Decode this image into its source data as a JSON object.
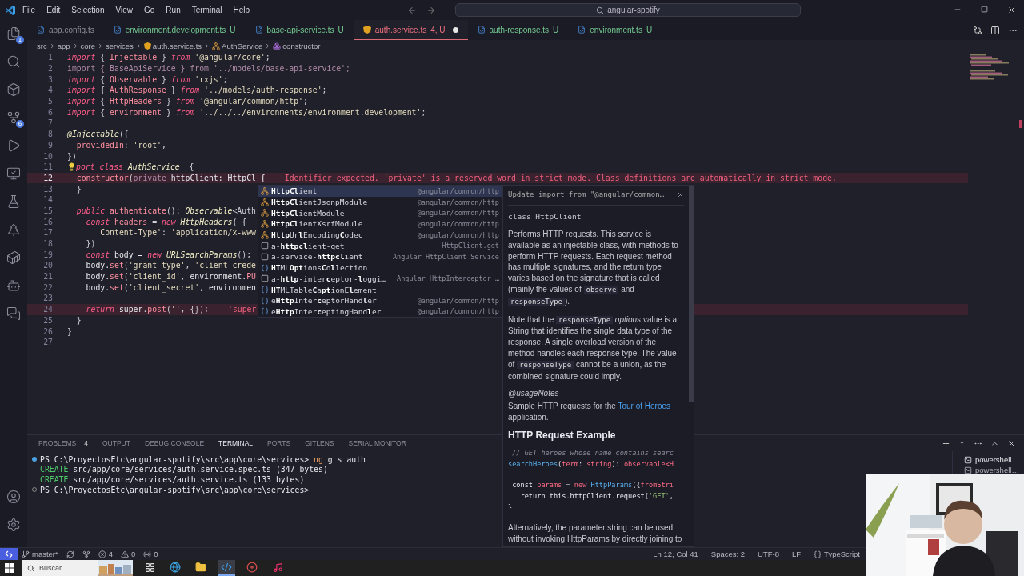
{
  "title_bar": {
    "menu": [
      "File",
      "Edit",
      "Selection",
      "View",
      "Go",
      "Run",
      "Terminal",
      "Help"
    ],
    "search": {
      "value": "angular-spotify"
    }
  },
  "activity_bar": {
    "top": [
      {
        "kind": "files",
        "badge": "1"
      },
      {
        "kind": "search"
      },
      {
        "kind": "extensions"
      },
      {
        "kind": "source-control",
        "badge": "6"
      },
      {
        "kind": "run"
      },
      {
        "kind": "remote"
      },
      {
        "kind": "testing"
      },
      {
        "kind": "tree"
      },
      {
        "kind": "docker"
      },
      {
        "kind": "bot"
      },
      {
        "kind": "chat"
      }
    ],
    "bottom": [
      {
        "kind": "account"
      },
      {
        "kind": "settings"
      }
    ]
  },
  "editor_tabs": [
    {
      "label": "app.config.ts",
      "kind": "clean",
      "selected": false
    },
    {
      "label": "environment.development.ts",
      "status": "U",
      "kind": "untracked",
      "selected": false
    },
    {
      "label": "base-api-service.ts",
      "status": "U",
      "kind": "untracked",
      "selected": false
    },
    {
      "label": "auth.service.ts",
      "status": "4, U",
      "kind": "error",
      "selected": true,
      "modified": true
    },
    {
      "label": "auth-response.ts",
      "status": "U",
      "kind": "untracked",
      "selected": false
    },
    {
      "label": "environment.ts",
      "status": "U",
      "kind": "untracked",
      "selected": false
    }
  ],
  "breadcrumbs": [
    {
      "label": "src",
      "kind": "folder"
    },
    {
      "label": "app",
      "kind": "folder"
    },
    {
      "label": "core",
      "kind": "folder"
    },
    {
      "label": "services",
      "kind": "folder"
    },
    {
      "label": "auth.service.ts",
      "kind": "file"
    },
    {
      "label": "AuthService",
      "kind": "class"
    },
    {
      "label": "constructor",
      "kind": "method"
    }
  ],
  "code_lines": [
    {
      "n": "1",
      "tokens": [
        {
          "text": "import ",
          "kind": "kw"
        },
        {
          "text": "{ ",
          "kind": "p"
        },
        {
          "text": "Injectable ",
          "kind": "id"
        },
        {
          "text": "} ",
          "kind": "p"
        },
        {
          "text": "from ",
          "kind": "kw"
        },
        {
          "text": "'@angular/core'",
          "kind": "str"
        },
        {
          "text": ";",
          "kind": "p"
        }
      ]
    },
    {
      "n": "2",
      "tokens": [
        {
          "text": "import { BaseApiService } from '../models/base-api-service';",
          "kind": "dim"
        }
      ]
    },
    {
      "n": "3",
      "tokens": [
        {
          "text": "import ",
          "kind": "kw"
        },
        {
          "text": "{ ",
          "kind": "p"
        },
        {
          "text": "Observable ",
          "kind": "id"
        },
        {
          "text": "} ",
          "kind": "p"
        },
        {
          "text": "from ",
          "kind": "kw"
        },
        {
          "text": "'rxjs'",
          "kind": "str"
        },
        {
          "text": ";",
          "kind": "p"
        }
      ]
    },
    {
      "n": "4",
      "tokens": [
        {
          "text": "import ",
          "kind": "kw"
        },
        {
          "text": "{ ",
          "kind": "p"
        },
        {
          "text": "AuthResponse ",
          "kind": "id"
        },
        {
          "text": "} ",
          "kind": "p"
        },
        {
          "text": "from ",
          "kind": "kw"
        },
        {
          "text": "'../models/auth-response'",
          "kind": "str"
        },
        {
          "text": ";",
          "kind": "p"
        }
      ]
    },
    {
      "n": "5",
      "tokens": [
        {
          "text": "import ",
          "kind": "kw"
        },
        {
          "text": "{ ",
          "kind": "p"
        },
        {
          "text": "HttpHeaders ",
          "kind": "id"
        },
        {
          "text": "} ",
          "kind": "p"
        },
        {
          "text": "from ",
          "kind": "kw"
        },
        {
          "text": "'@angular/common/http'",
          "kind": "str"
        },
        {
          "text": ";",
          "kind": "p"
        }
      ]
    },
    {
      "n": "6",
      "tokens": [
        {
          "text": "import ",
          "kind": "kw"
        },
        {
          "text": "{ ",
          "kind": "p"
        },
        {
          "text": "environment ",
          "kind": "id"
        },
        {
          "text": "} ",
          "kind": "p"
        },
        {
          "text": "from ",
          "kind": "kw"
        },
        {
          "text": "'../../../environments/environment.development'",
          "kind": "str"
        },
        {
          "text": ";",
          "kind": "p"
        }
      ]
    },
    {
      "n": "7"
    },
    {
      "n": "8",
      "tokens": [
        {
          "text": "@Injectable",
          "kind": "type"
        },
        {
          "text": "({",
          "kind": "p"
        }
      ]
    },
    {
      "n": "9",
      "tokens": [
        {
          "text": "  providedIn",
          "kind": "id"
        },
        {
          "text": ": ",
          "kind": "p"
        },
        {
          "text": "'root'",
          "kind": "str"
        },
        {
          "text": ",",
          "kind": "p"
        }
      ]
    },
    {
      "n": "10",
      "tokens": [
        {
          "text": "})",
          "kind": "p"
        }
      ]
    },
    {
      "n": "11",
      "lightbulb": true,
      "tokens": [
        {
          "text": "port ",
          "kind": "kw"
        },
        {
          "text": "class ",
          "kind": "kw"
        },
        {
          "text": "AuthService",
          "kind": "type"
        },
        {
          "text": "  {",
          "kind": "p"
        }
      ]
    },
    {
      "n": "12",
      "current": true,
      "error": "Identifier expected. 'private' is a reserved word in strict mode. Class definitions are automatically in strict mode.",
      "tokens": [
        {
          "text": "  constructor",
          "kind": "id"
        },
        {
          "text": "(",
          "kind": "p"
        },
        {
          "text": "private",
          "kind": "dim"
        },
        {
          "text": " httpClient: HttpCl {",
          "kind": "plain"
        }
      ]
    },
    {
      "n": "13",
      "tokens": [
        {
          "text": "  }",
          "kind": "p"
        }
      ]
    },
    {
      "n": "14"
    },
    {
      "n": "15",
      "tokens": [
        {
          "text": "  public ",
          "kind": "kw"
        },
        {
          "text": "authenticate",
          "kind": "fn"
        },
        {
          "text": "(): ",
          "kind": "p"
        },
        {
          "text": "Observable",
          "kind": "type"
        },
        {
          "text": "<Auth",
          "kind": "p"
        }
      ]
    },
    {
      "n": "16",
      "tokens": [
        {
          "text": "    const ",
          "kind": "kw"
        },
        {
          "text": "headers",
          "kind": "id"
        },
        {
          "text": " = ",
          "kind": "p"
        },
        {
          "text": "new ",
          "kind": "kw"
        },
        {
          "text": "HttpHeaders",
          "kind": "type"
        },
        {
          "text": "( {",
          "kind": "p"
        }
      ]
    },
    {
      "n": "17",
      "tokens": [
        {
          "text": "      'Content-Type'",
          "kind": "str"
        },
        {
          "text": ": ",
          "kind": "p"
        },
        {
          "text": "'application/x-www",
          "kind": "str"
        }
      ]
    },
    {
      "n": "18",
      "tokens": [
        {
          "text": "    })",
          "kind": "p"
        }
      ]
    },
    {
      "n": "19",
      "tokens": [
        {
          "text": "    const ",
          "kind": "kw"
        },
        {
          "text": "body = ",
          "kind": "plain"
        },
        {
          "text": "new ",
          "kind": "kw"
        },
        {
          "text": "URLSearchParams",
          "kind": "type"
        },
        {
          "text": "();",
          "kind": "p"
        }
      ]
    },
    {
      "n": "20",
      "tokens": [
        {
          "text": "    body.",
          "kind": "plain"
        },
        {
          "text": "set",
          "kind": "fn"
        },
        {
          "text": "(",
          "kind": "p"
        },
        {
          "text": "'grant_type'",
          "kind": "str"
        },
        {
          "text": ", ",
          "kind": "p"
        },
        {
          "text": "'client_crede",
          "kind": "str"
        }
      ]
    },
    {
      "n": "21",
      "tokens": [
        {
          "text": "    body.",
          "kind": "plain"
        },
        {
          "text": "set",
          "kind": "fn"
        },
        {
          "text": "(",
          "kind": "p"
        },
        {
          "text": "'client_id'",
          "kind": "str"
        },
        {
          "text": ", environment.",
          "kind": "plain"
        },
        {
          "text": "PU",
          "kind": "id"
        }
      ]
    },
    {
      "n": "22",
      "tokens": [
        {
          "text": "    body.",
          "kind": "plain"
        },
        {
          "text": "set",
          "kind": "fn"
        },
        {
          "text": "(",
          "kind": "p"
        },
        {
          "text": "'client_secret'",
          "kind": "str"
        },
        {
          "text": ", environmen",
          "kind": "plain"
        }
      ]
    },
    {
      "n": "23"
    },
    {
      "n": "24",
      "error": "'super",
      "tokens": [
        {
          "text": "    return ",
          "kind": "kw"
        },
        {
          "text": "super",
          "kind": "plain"
        },
        {
          "text": ".",
          "kind": "p"
        },
        {
          "text": "post",
          "kind": "fn"
        },
        {
          "text": "(",
          "kind": "p"
        },
        {
          "text": "''",
          "kind": "str"
        },
        {
          "text": ", {});",
          "kind": "p"
        }
      ]
    },
    {
      "n": "25",
      "tokens": [
        {
          "text": "  }",
          "kind": "p"
        }
      ]
    },
    {
      "n": "26",
      "tokens": [
        {
          "text": "}",
          "kind": "p"
        }
      ]
    },
    {
      "n": "27"
    }
  ],
  "suggestions": [
    {
      "kind": "class",
      "label": "**HttpCl**ient",
      "detail": "@angular/common/http",
      "selected": true
    },
    {
      "kind": "class",
      "label": "**HttpCl**ientJsonpModule",
      "detail": "@angular/common/http",
      "selected": false
    },
    {
      "kind": "class",
      "label": "**HttpCl**ientModule",
      "detail": "@angular/common/http",
      "selected": false
    },
    {
      "kind": "class",
      "label": "**HttpCl**ientXsrfModule",
      "detail": "@angular/common/http",
      "selected": false
    },
    {
      "kind": "class",
      "label": "**Http**Ur**l**Encoding**C**odec",
      "detail": "@angular/common/http",
      "selected": false
    },
    {
      "kind": "snippet",
      "label": "a-**httpcl**ient-get",
      "detail": "HttpClient.get",
      "selected": false
    },
    {
      "kind": "snippet",
      "label": "a-service-**httpcl**ient",
      "detail": "Angular HttpClient Service",
      "selected": false
    },
    {
      "kind": "field",
      "label": "**HT**ML**Opt**ions**C**o**l**lection",
      "selected": false
    },
    {
      "kind": "snippet",
      "label": "a-**http**-inter**c**eptor-**l**oggi…",
      "detail": "Angular HttpInterceptor …",
      "selected": false
    },
    {
      "kind": "field",
      "label": "**HT**MLTable**C**a**pt**ionE**l**ement",
      "selected": false
    },
    {
      "kind": "field",
      "label": "e**Http**Inter**c**eptorHand**l**er",
      "detail": "@angular/common/http",
      "selected": false
    },
    {
      "kind": "field",
      "label": "e**Http**Inter**c**eptingHand**l**er",
      "detail": "@angular/common/http",
      "selected": false
    }
  ],
  "docs": {
    "header": "Update import from \"@angular/common…",
    "signature": "class HttpClient",
    "blocks": [
      {
        "kind": "para",
        "segments": [
          {
            "kind": "text",
            "text": "Performs HTTP requests. This service is available as an injectable class, with methods to perform HTTP requests. Each request method has multiple signatures, and the return type varies based on the signature that is called (mainly the values of "
          },
          {
            "kind": "code",
            "text": "observe"
          },
          {
            "kind": "text",
            "text": " and "
          },
          {
            "kind": "code",
            "text": "responseType"
          },
          {
            "kind": "text",
            "text": ")."
          }
        ]
      },
      {
        "kind": "para",
        "segments": [
          {
            "kind": "text",
            "text": "Note that the "
          },
          {
            "kind": "code",
            "text": "responseType"
          },
          {
            "kind": "em",
            "text": " options"
          },
          {
            "kind": "text",
            "text": " value is a String that identifies the single data type of the response. A single overload version of the method handles each response type. The value of "
          },
          {
            "kind": "code",
            "text": "responseType"
          },
          {
            "kind": "text",
            "text": " cannot be a union, as the combined signature could imply."
          }
        ]
      },
      {
        "kind": "tight",
        "segments": [
          {
            "kind": "em",
            "text": "@usageNotes"
          }
        ]
      },
      {
        "kind": "para",
        "segments": [
          {
            "kind": "text",
            "text": "Sample HTTP requests for the "
          },
          {
            "kind": "link",
            "text": "Tour of Heroes"
          },
          {
            "kind": "text",
            "text": " application."
          }
        ]
      },
      {
        "kind": "heading",
        "segments": [
          {
            "kind": "text",
            "text": "HTTP Request Example"
          }
        ]
      },
      {
        "kind": "code",
        "lines": [
          [
            {
              "kind": "comment",
              "text": " // GET heroes whose name contains searc"
            }
          ],
          [
            {
              "kind": "blue",
              "text": "searchHeroes"
            },
            {
              "kind": "plain",
              "text": "("
            },
            {
              "kind": "red",
              "text": "term"
            },
            {
              "kind": "plain",
              "text": ": "
            },
            {
              "kind": "red",
              "text": "string"
            },
            {
              "kind": "plain",
              "text": "): "
            },
            {
              "kind": "red",
              "text": "observable<H"
            }
          ]
        ]
      },
      {
        "kind": "code",
        "lines": [
          [
            {
              "kind": "plain",
              "text": " const "
            },
            {
              "kind": "red",
              "text": "params"
            },
            {
              "kind": "plain",
              "text": " = "
            },
            {
              "kind": "red",
              "text": "new "
            },
            {
              "kind": "blue",
              "text": "HttpParams"
            },
            {
              "kind": "plain",
              "text": "({"
            },
            {
              "kind": "red",
              "text": "fromStri"
            }
          ],
          [
            {
              "kind": "plain",
              "text": "   return this.httpClient.request("
            },
            {
              "kind": "green",
              "text": "'GET'"
            },
            {
              "kind": "plain",
              "text": ","
            }
          ],
          [
            {
              "kind": "plain",
              "text": "}"
            }
          ]
        ]
      },
      {
        "kind": "para",
        "segments": [
          {
            "kind": "text",
            "text": "Alternatively, the parameter string can be used without invoking HttpParams by directly joining to"
          }
        ]
      }
    ]
  },
  "panel": {
    "tabs": [
      {
        "label": "PROBLEMS",
        "badge": "4",
        "selected": false
      },
      {
        "label": "OUTPUT",
        "selected": false
      },
      {
        "label": "DEBUG CONSOLE",
        "selected": false
      },
      {
        "label": "TERMINAL",
        "selected": true
      },
      {
        "label": "PORTS",
        "selected": false
      },
      {
        "label": "GITLENS",
        "selected": false
      },
      {
        "label": "SERIAL MONITOR",
        "selected": false
      }
    ],
    "terminal_lines": [
      {
        "marker": true,
        "succeeded": true,
        "tokens": [
          {
            "kind": "plain",
            "text": "PS C:\\ProyectosEtc\\angular-spotify\\src\\app\\core\\services> "
          },
          {
            "kind": "cmd",
            "text": "ng"
          },
          {
            "kind": "plain",
            "text": " g s auth"
          }
        ]
      },
      {
        "tokens": [
          {
            "kind": "ok",
            "text": "CREATE"
          },
          {
            "kind": "plain",
            "text": " src/app/core/services/auth.service.spec.ts (347 bytes)"
          }
        ]
      },
      {
        "tokens": [
          {
            "kind": "ok",
            "text": "CREATE"
          },
          {
            "kind": "plain",
            "text": " src/app/core/services/auth.service.ts (133 bytes)"
          }
        ]
      },
      {
        "marker": true,
        "succeeded": false,
        "cursor": true,
        "tokens": [
          {
            "kind": "plain",
            "text": "PS C:\\ProyectosEtc\\angular-spotify\\src\\app\\core\\services>"
          }
        ]
      }
    ],
    "terminals": [
      {
        "label": "powershell",
        "selected": true
      },
      {
        "label": "powershell…",
        "selected": false
      }
    ]
  },
  "status_bar": {
    "left": [
      {
        "kind": "remote"
      },
      {
        "kind": "branch",
        "text": "master*"
      },
      {
        "kind": "sync"
      },
      {
        "kind": "graph"
      },
      {
        "kind": "errors",
        "text": "4"
      },
      {
        "kind": "warnings",
        "text": "0"
      },
      {
        "kind": "ports",
        "text": "0"
      }
    ],
    "right": [
      {
        "kind": "plain",
        "text": "Ln 12, Col 41"
      },
      {
        "kind": "plain",
        "text": "Spaces: 2"
      },
      {
        "kind": "plain",
        "text": "UTF-8"
      },
      {
        "kind": "plain",
        "text": "LF"
      },
      {
        "kind": "language",
        "text": "TypeScript"
      }
    ]
  },
  "taskbar": {
    "search": {
      "placeholder": "Buscar"
    },
    "apps": [
      {
        "kind": "taskview",
        "selected": false
      },
      {
        "kind": "browser",
        "selected": false
      },
      {
        "kind": "files",
        "selected": false
      },
      {
        "kind": "editor",
        "selected": true
      },
      {
        "kind": "recorder",
        "selected": false
      },
      {
        "kind": "music",
        "selected": false
      }
    ]
  }
}
